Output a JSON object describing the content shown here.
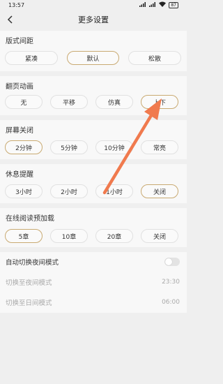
{
  "status": {
    "time": "13:57",
    "battery": "87"
  },
  "header": {
    "title": "更多设置"
  },
  "sections": {
    "layout": {
      "title": "版式间距",
      "options": [
        "紧凑",
        "默认",
        "松散"
      ]
    },
    "animation": {
      "title": "翻页动画",
      "options": [
        "无",
        "平移",
        "仿真",
        "上下"
      ]
    },
    "screen_off": {
      "title": "屏幕关闭",
      "options": [
        "2分钟",
        "5分钟",
        "10分钟",
        "常亮"
      ]
    },
    "rest_reminder": {
      "title": "休息提醒",
      "options": [
        "3小时",
        "2小时",
        "1小时",
        "关闭"
      ]
    },
    "preload": {
      "title": "在线阅读预加载",
      "options": [
        "5章",
        "10章",
        "20章",
        "关闭"
      ]
    }
  },
  "night": {
    "auto_label": "自动切换夜间模式",
    "to_night_label": "切换至夜间模式",
    "to_night_time": "23:30",
    "to_day_label": "切换至日间模式",
    "to_day_time": "06:00"
  },
  "colors": {
    "accent_border": "#c9aa72",
    "arrow": "#f07a4e"
  }
}
